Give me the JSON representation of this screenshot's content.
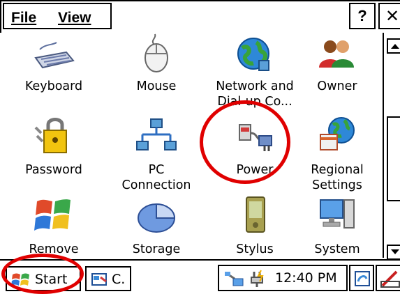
{
  "menubar": {
    "items": [
      {
        "label": "File"
      },
      {
        "label": "View"
      }
    ],
    "help_label": "?",
    "close_label": "✕"
  },
  "control_panel": {
    "items": [
      {
        "label": "Keyboard",
        "icon": "keyboard-icon"
      },
      {
        "label": "Mouse",
        "icon": "mouse-icon"
      },
      {
        "label": "Network and\nDial-up Co...",
        "icon": "network-icon"
      },
      {
        "label": "Owner",
        "icon": "owner-icon"
      },
      {
        "label": "Password",
        "icon": "password-icon"
      },
      {
        "label": "PC\nConnection",
        "icon": "pc-connection-icon"
      },
      {
        "label": "Power",
        "icon": "power-icon"
      },
      {
        "label": "Regional\nSettings",
        "icon": "regional-settings-icon"
      },
      {
        "label": "Remove",
        "icon": "remove-programs-icon"
      },
      {
        "label": "Storage",
        "icon": "storage-icon"
      },
      {
        "label": "Stylus",
        "icon": "stylus-icon"
      },
      {
        "label": "System",
        "icon": "system-icon"
      }
    ]
  },
  "taskbar": {
    "start_label": "Start",
    "task_label": "C.",
    "clock": "12:40 PM"
  },
  "annotations": {
    "color": "#e00000",
    "highlighted": [
      "Power",
      "Start"
    ]
  }
}
